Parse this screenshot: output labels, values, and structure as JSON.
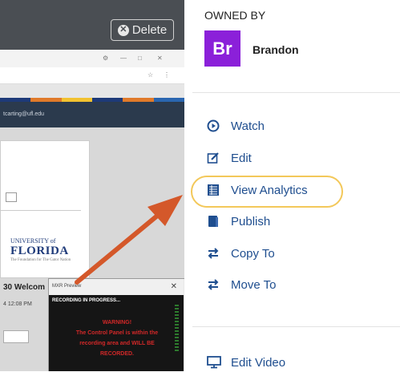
{
  "preview": {
    "delete_label": "Delete",
    "nav_email": "tcarting@ufl.edu",
    "university_line1": "UNIVERSITY of",
    "university_line2": "FLORIDA",
    "university_line3": "The Foundation for The Gator Nation",
    "welcome_title": "30 Welcom",
    "welcome_time": "4 12:08 PM",
    "popup_title": "MXR Preview",
    "popup_recording": "RECORDING IN PROGRESS...",
    "popup_warning": "WARNING!",
    "popup_warning_body": "The Control Panel is within the recording area and WILL BE RECORDED."
  },
  "owner": {
    "label": "OWNED BY",
    "initials": "Br",
    "name": "Brandon",
    "avatar_color": "#8b20d9"
  },
  "menu": [
    {
      "label": "Watch",
      "icon": "play-circle-icon"
    },
    {
      "label": "Edit",
      "icon": "edit-icon"
    },
    {
      "label": "View Analytics",
      "icon": "analytics-icon"
    },
    {
      "label": "Publish",
      "icon": "publish-icon"
    },
    {
      "label": "Copy To",
      "icon": "copy-arrows-icon"
    },
    {
      "label": "Move To",
      "icon": "move-arrows-icon"
    }
  ],
  "secondary_menu": [
    {
      "label": "Edit Video",
      "icon": "monitor-icon"
    }
  ],
  "colors": {
    "link": "#1f4e8f",
    "highlight_ring": "#f3c85a",
    "annotation_arrow": "#d4582a"
  }
}
